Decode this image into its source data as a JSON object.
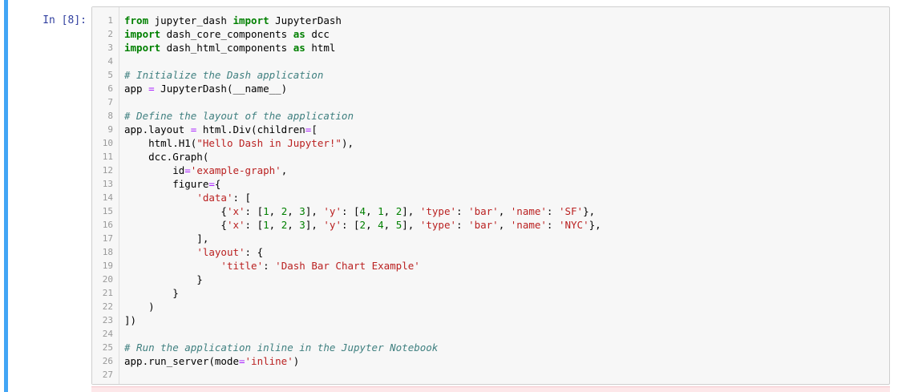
{
  "cell": {
    "prompt": "In [8]:",
    "lines": [
      {
        "n": "1",
        "tokens": [
          {
            "t": "from",
            "c": "kw"
          },
          {
            "t": " jupyter_dash ",
            "c": ""
          },
          {
            "t": "import",
            "c": "kw"
          },
          {
            "t": " JupyterDash",
            "c": ""
          }
        ]
      },
      {
        "n": "2",
        "tokens": [
          {
            "t": "import",
            "c": "kw"
          },
          {
            "t": " dash_core_components ",
            "c": ""
          },
          {
            "t": "as",
            "c": "kw"
          },
          {
            "t": " dcc",
            "c": ""
          }
        ]
      },
      {
        "n": "3",
        "tokens": [
          {
            "t": "import",
            "c": "kw"
          },
          {
            "t": " dash_html_components ",
            "c": ""
          },
          {
            "t": "as",
            "c": "kw"
          },
          {
            "t": " html",
            "c": ""
          }
        ]
      },
      {
        "n": "4",
        "tokens": []
      },
      {
        "n": "5",
        "tokens": [
          {
            "t": "# Initialize the Dash application",
            "c": "cm"
          }
        ]
      },
      {
        "n": "6",
        "tokens": [
          {
            "t": "app ",
            "c": ""
          },
          {
            "t": "=",
            "c": "op"
          },
          {
            "t": " JupyterDash(__name__)",
            "c": ""
          }
        ]
      },
      {
        "n": "7",
        "tokens": []
      },
      {
        "n": "8",
        "tokens": [
          {
            "t": "# Define the layout of the application",
            "c": "cm"
          }
        ]
      },
      {
        "n": "9",
        "tokens": [
          {
            "t": "app.layout ",
            "c": ""
          },
          {
            "t": "=",
            "c": "op"
          },
          {
            "t": " html.Div(children",
            "c": ""
          },
          {
            "t": "=",
            "c": "op"
          },
          {
            "t": "[",
            "c": ""
          }
        ]
      },
      {
        "n": "10",
        "tokens": [
          {
            "t": "    html.H1(",
            "c": ""
          },
          {
            "t": "\"Hello Dash in Jupyter!\"",
            "c": "st"
          },
          {
            "t": "),",
            "c": ""
          }
        ]
      },
      {
        "n": "11",
        "tokens": [
          {
            "t": "    dcc.Graph(",
            "c": ""
          }
        ]
      },
      {
        "n": "12",
        "tokens": [
          {
            "t": "        id",
            "c": ""
          },
          {
            "t": "=",
            "c": "op"
          },
          {
            "t": "'example-graph'",
            "c": "st"
          },
          {
            "t": ",",
            "c": ""
          }
        ]
      },
      {
        "n": "13",
        "tokens": [
          {
            "t": "        figure",
            "c": ""
          },
          {
            "t": "=",
            "c": "op"
          },
          {
            "t": "{",
            "c": ""
          }
        ]
      },
      {
        "n": "14",
        "tokens": [
          {
            "t": "            ",
            "c": ""
          },
          {
            "t": "'data'",
            "c": "st"
          },
          {
            "t": ": [",
            "c": ""
          }
        ]
      },
      {
        "n": "15",
        "tokens": [
          {
            "t": "                {",
            "c": ""
          },
          {
            "t": "'x'",
            "c": "st"
          },
          {
            "t": ": [",
            "c": ""
          },
          {
            "t": "1",
            "c": "nm"
          },
          {
            "t": ", ",
            "c": ""
          },
          {
            "t": "2",
            "c": "nm"
          },
          {
            "t": ", ",
            "c": ""
          },
          {
            "t": "3",
            "c": "nm"
          },
          {
            "t": "], ",
            "c": ""
          },
          {
            "t": "'y'",
            "c": "st"
          },
          {
            "t": ": [",
            "c": ""
          },
          {
            "t": "4",
            "c": "nm"
          },
          {
            "t": ", ",
            "c": ""
          },
          {
            "t": "1",
            "c": "nm"
          },
          {
            "t": ", ",
            "c": ""
          },
          {
            "t": "2",
            "c": "nm"
          },
          {
            "t": "], ",
            "c": ""
          },
          {
            "t": "'type'",
            "c": "st"
          },
          {
            "t": ": ",
            "c": ""
          },
          {
            "t": "'bar'",
            "c": "st"
          },
          {
            "t": ", ",
            "c": ""
          },
          {
            "t": "'name'",
            "c": "st"
          },
          {
            "t": ": ",
            "c": ""
          },
          {
            "t": "'SF'",
            "c": "st"
          },
          {
            "t": "},",
            "c": ""
          }
        ]
      },
      {
        "n": "16",
        "tokens": [
          {
            "t": "                {",
            "c": ""
          },
          {
            "t": "'x'",
            "c": "st"
          },
          {
            "t": ": [",
            "c": ""
          },
          {
            "t": "1",
            "c": "nm"
          },
          {
            "t": ", ",
            "c": ""
          },
          {
            "t": "2",
            "c": "nm"
          },
          {
            "t": ", ",
            "c": ""
          },
          {
            "t": "3",
            "c": "nm"
          },
          {
            "t": "], ",
            "c": ""
          },
          {
            "t": "'y'",
            "c": "st"
          },
          {
            "t": ": [",
            "c": ""
          },
          {
            "t": "2",
            "c": "nm"
          },
          {
            "t": ", ",
            "c": ""
          },
          {
            "t": "4",
            "c": "nm"
          },
          {
            "t": ", ",
            "c": ""
          },
          {
            "t": "5",
            "c": "nm"
          },
          {
            "t": "], ",
            "c": ""
          },
          {
            "t": "'type'",
            "c": "st"
          },
          {
            "t": ": ",
            "c": ""
          },
          {
            "t": "'bar'",
            "c": "st"
          },
          {
            "t": ", ",
            "c": ""
          },
          {
            "t": "'name'",
            "c": "st"
          },
          {
            "t": ": ",
            "c": ""
          },
          {
            "t": "'NYC'",
            "c": "st"
          },
          {
            "t": "},",
            "c": ""
          }
        ]
      },
      {
        "n": "17",
        "tokens": [
          {
            "t": "            ],",
            "c": ""
          }
        ]
      },
      {
        "n": "18",
        "tokens": [
          {
            "t": "            ",
            "c": ""
          },
          {
            "t": "'layout'",
            "c": "st"
          },
          {
            "t": ": {",
            "c": ""
          }
        ]
      },
      {
        "n": "19",
        "tokens": [
          {
            "t": "                ",
            "c": ""
          },
          {
            "t": "'title'",
            "c": "st"
          },
          {
            "t": ": ",
            "c": ""
          },
          {
            "t": "'Dash Bar Chart Example'",
            "c": "st"
          }
        ]
      },
      {
        "n": "20",
        "tokens": [
          {
            "t": "            }",
            "c": ""
          }
        ]
      },
      {
        "n": "21",
        "tokens": [
          {
            "t": "        }",
            "c": ""
          }
        ]
      },
      {
        "n": "22",
        "tokens": [
          {
            "t": "    )",
            "c": ""
          }
        ]
      },
      {
        "n": "23",
        "tokens": [
          {
            "t": "])",
            "c": ""
          }
        ]
      },
      {
        "n": "24",
        "tokens": []
      },
      {
        "n": "25",
        "tokens": [
          {
            "t": "# Run the application inline in the Jupyter Notebook",
            "c": "cm"
          }
        ]
      },
      {
        "n": "26",
        "tokens": [
          {
            "t": "app.run_server(mode",
            "c": ""
          },
          {
            "t": "=",
            "c": "op"
          },
          {
            "t": "'inline'",
            "c": "st"
          },
          {
            "t": ")",
            "c": ""
          }
        ]
      },
      {
        "n": "27",
        "tokens": []
      }
    ]
  },
  "colors": {
    "selection_bar": "#42a5f5",
    "prompt": "#303f9f",
    "keyword": "#008000",
    "comment": "#408080",
    "string": "#ba2121",
    "number": "#008000",
    "operator": "#aa22ff",
    "editor_bg": "#f7f7f7"
  }
}
